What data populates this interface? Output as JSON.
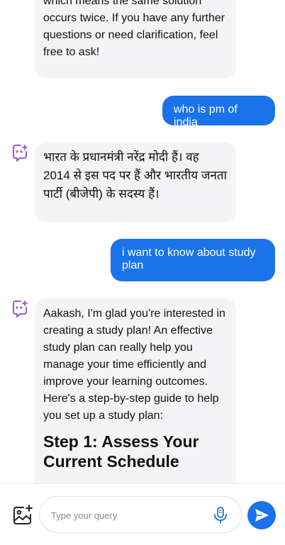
{
  "messages": {
    "bot_1": "which means the same solution occurs twice. If you have any further questions or need clarification, feel free to ask!",
    "user_1": "who is pm of india",
    "bot_2": "भारत के प्रधानमंत्री नरेंद्र मोदी हैं। वह 2014 से इस पद पर हैं और भारतीय जनता पार्टी (बीजेपी) के सदस्य हैं।",
    "user_2": "i want to know about study plan",
    "bot_3_text": "Aakash, I'm glad you're interested in creating a study plan! An effective study plan can really help you manage your time efficiently and improve your learning outcomes. Here's a step-by-step guide to help you set up a study plan:",
    "bot_3_heading": "Step 1: Assess Your Current Schedule"
  },
  "composer": {
    "placeholder": "Type your query"
  },
  "icons": {
    "bot": "sparkle-chat-icon",
    "gallery": "image-add-icon",
    "mic": "microphone-icon",
    "send": "send-icon"
  },
  "colors": {
    "accent": "#1a73e8",
    "bot_bubble": "#f4f4f6",
    "bot_icon": "#9b59d0"
  }
}
